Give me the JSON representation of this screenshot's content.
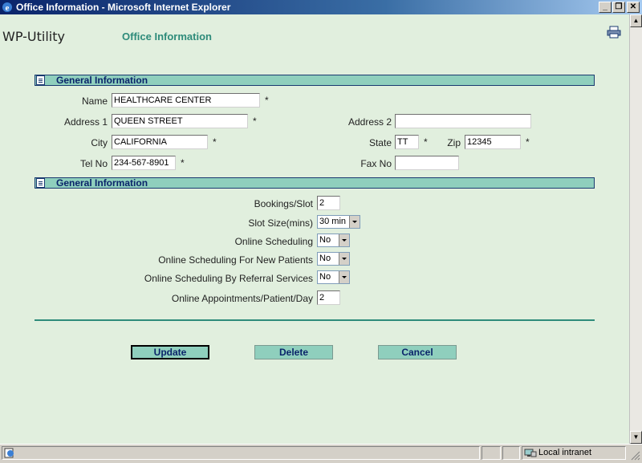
{
  "window": {
    "title": "Office Information - Microsoft Internet Explorer",
    "min_glyph": "_",
    "max_glyph": "❐",
    "close_glyph": "✕"
  },
  "header": {
    "app_title": "WP-Utility",
    "page_title": "Office Information"
  },
  "sections": [
    {
      "label": "General Information"
    },
    {
      "label": "General Information"
    }
  ],
  "office": {
    "name": {
      "label": "Name",
      "value": "HEALTHCARE CENTER"
    },
    "address1": {
      "label": "Address 1",
      "value": "QUEEN STREET"
    },
    "address2": {
      "label": "Address 2",
      "value": ""
    },
    "city": {
      "label": "City",
      "value": "CALIFORNIA"
    },
    "state": {
      "label": "State",
      "value": "TT"
    },
    "zip": {
      "label": "Zip",
      "value": "12345"
    },
    "tel": {
      "label": "Tel No",
      "value": "234-567-8901"
    },
    "fax": {
      "label": "Fax No",
      "value": ""
    },
    "required_mark": "*"
  },
  "scheduling": {
    "bookings_per_slot": {
      "label": "Bookings/Slot",
      "value": "2"
    },
    "slot_size": {
      "label": "Slot Size(mins)",
      "value": "30 min"
    },
    "online_scheduling": {
      "label": "Online Scheduling",
      "value": "No"
    },
    "online_new_patients": {
      "label": "Online Scheduling For New Patients",
      "value": "No"
    },
    "online_referral": {
      "label": "Online Scheduling By Referral Services",
      "value": "No"
    },
    "appointments_per_day": {
      "label": "Online Appointments/Patient/Day",
      "value": "2"
    }
  },
  "buttons": {
    "update": "Update",
    "delete": "Delete",
    "cancel": "Cancel"
  },
  "statusbar": {
    "zone": "Local intranet"
  },
  "colors": {
    "page_bg": "#e1efde",
    "section_bg": "#8fcfbd",
    "accent": "#2e8b7a"
  }
}
